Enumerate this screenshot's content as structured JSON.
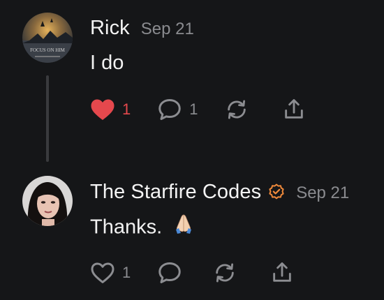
{
  "posts": [
    {
      "author": "Rick",
      "date": "Sep 21",
      "text": "I do",
      "avatar_caption": "FOCUS ON HIM",
      "liked": true,
      "like_count": "1",
      "comment_count": "1",
      "verified": false
    },
    {
      "author": "The Starfire Codes",
      "date": "Sep 21",
      "text": "Thanks.",
      "liked": false,
      "like_count": "1",
      "comment_count": "",
      "verified": true
    }
  ],
  "icons": {
    "like": "heart-icon",
    "comment": "comment-bubble-icon",
    "repost": "repost-icon",
    "share": "share-icon",
    "verified": "verified-badge-icon",
    "emoji": "folded-hands-emoji"
  },
  "colors": {
    "background": "#151618",
    "like_active": "#e5484d",
    "icon_muted": "#8c8d91",
    "verified": "#f08a3b"
  }
}
